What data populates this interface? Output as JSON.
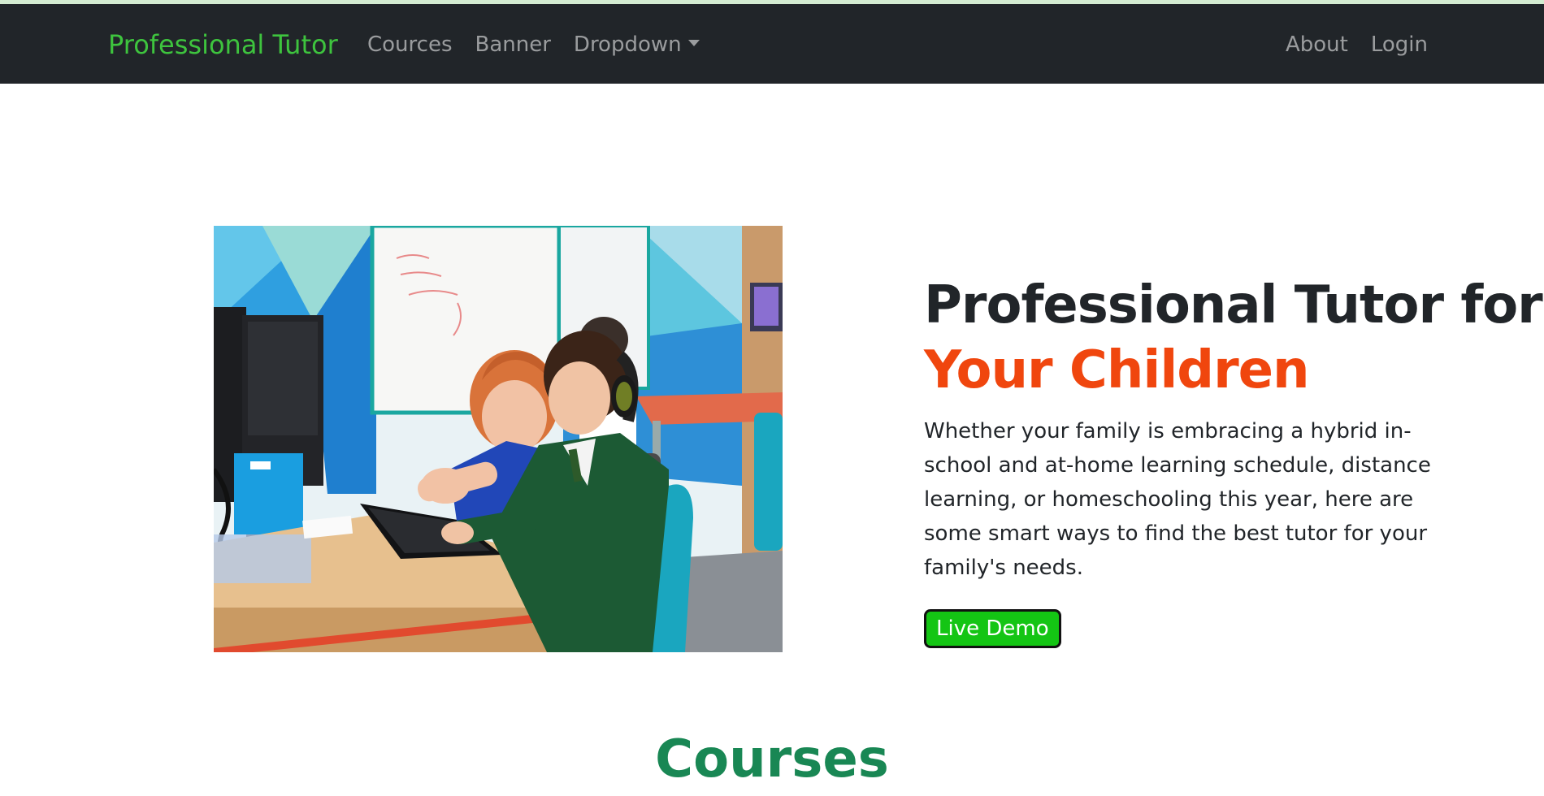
{
  "nav": {
    "brand": "Professional Tutor",
    "left_links": [
      "Cources",
      "Banner",
      "Dropdown"
    ],
    "right_links": [
      "About",
      "Login"
    ]
  },
  "hero": {
    "headline_line1": "Professional Tutor for",
    "headline_line2": "Your Children",
    "lead": "Whether your family is embracing a hybrid in-school and at-home learning schedule, distance learning, or homeschooling this year, here are some smart ways to find the best tutor for your family's needs.",
    "button_label": "Live Demo"
  },
  "courses_section": {
    "title": "Courses"
  },
  "colors": {
    "navbar_bg": "#212529",
    "brand": "#3ec43e",
    "headline_accent": "#f0460e",
    "button_bg": "#14c514",
    "section_title": "#198754"
  }
}
